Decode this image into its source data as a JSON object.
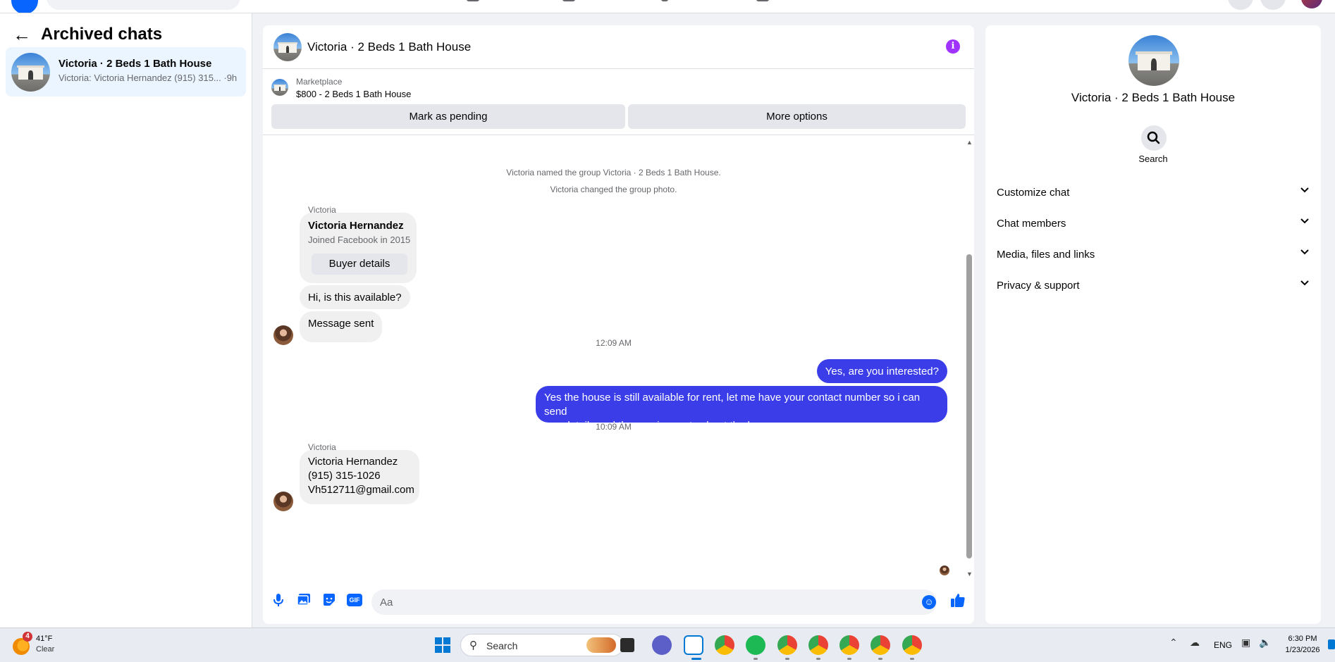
{
  "archived": {
    "title": "Archived chats",
    "chats": [
      {
        "name": "Victoria · 2 Beds 1 Bath House",
        "preview": "Victoria: Victoria Hernandez (915) 315... ·9h"
      }
    ]
  },
  "conversation": {
    "title": "Victoria · 2 Beds 1 Bath House",
    "listing": {
      "source": "Marketplace",
      "title": "$800 - 2 Beds 1 Bath House",
      "mark_pending": "Mark as pending",
      "more_options": "More options"
    },
    "system_messages": [
      "Victoria named the group Victoria · 2 Beds 1 Bath House.",
      "Victoria changed the group photo."
    ],
    "sender_name": "Victoria",
    "buyer_card": {
      "name": "Victoria Hernandez",
      "subtitle": "Joined Facebook in 2015",
      "button": "Buyer details"
    },
    "incoming_1": "Hi, is this available?",
    "incoming_2": "Message sent",
    "timestamp_1": "12:09 AM",
    "outgoing_1": "Yes, are you interested?",
    "outgoing_2_line1": "Yes the house is still available for rent, let me have your contact number so i can send",
    "outgoing_2_line2": "you details and the requirements about the house",
    "timestamp_2": "10:09 AM",
    "contact_lines": [
      "Victoria Hernandez",
      "(915) 315-1026",
      "Vh512711@gmail.com"
    ],
    "composer_placeholder": "Aa",
    "icons": [
      "microphone-icon",
      "image-icon",
      "sticker-icon",
      "gif-icon",
      "emoji-icon",
      "thumbs-up-icon"
    ],
    "gif_label": "GIF"
  },
  "details": {
    "name": "Victoria · 2 Beds 1 Bath House",
    "search_label": "Search",
    "sections": [
      "Customize chat",
      "Chat members",
      "Media, files and links",
      "Privacy & support"
    ]
  },
  "taskbar": {
    "weather_badge": "4",
    "temperature": "41°F",
    "condition": "Clear",
    "search_label": "Search",
    "language": "ENG",
    "time": "6:30 PM",
    "date": "1/23/2026"
  },
  "colors": {
    "outgoing_bubble": "#3a3de8",
    "accent": "#0866ff",
    "info": "#a033ff",
    "selected_chat": "#ebf5ff"
  }
}
